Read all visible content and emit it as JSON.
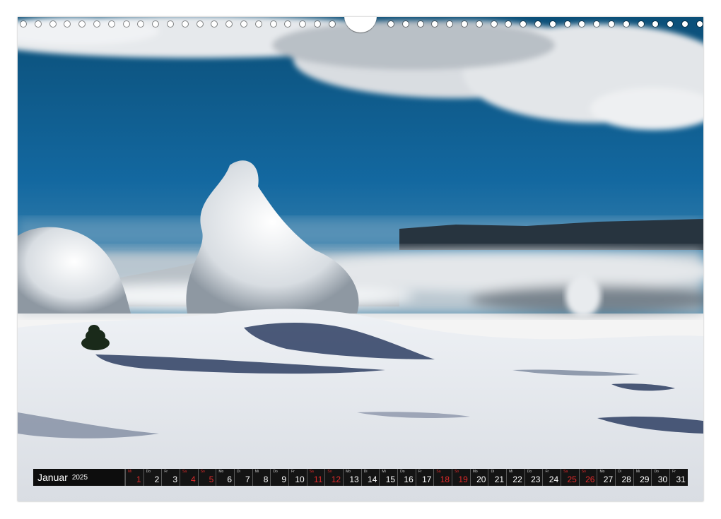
{
  "calendar": {
    "month": "Januar",
    "year": "2025",
    "days": [
      {
        "num": "1",
        "wd": "Mi",
        "weekend": true
      },
      {
        "num": "2",
        "wd": "Do",
        "weekend": false
      },
      {
        "num": "3",
        "wd": "Fr",
        "weekend": false
      },
      {
        "num": "4",
        "wd": "Sa",
        "weekend": true
      },
      {
        "num": "5",
        "wd": "So",
        "weekend": true
      },
      {
        "num": "6",
        "wd": "Mo",
        "weekend": false
      },
      {
        "num": "7",
        "wd": "Di",
        "weekend": false
      },
      {
        "num": "8",
        "wd": "Mi",
        "weekend": false
      },
      {
        "num": "9",
        "wd": "Do",
        "weekend": false
      },
      {
        "num": "10",
        "wd": "Fr",
        "weekend": false
      },
      {
        "num": "11",
        "wd": "Sa",
        "weekend": true
      },
      {
        "num": "12",
        "wd": "So",
        "weekend": true
      },
      {
        "num": "13",
        "wd": "Mo",
        "weekend": false
      },
      {
        "num": "14",
        "wd": "Di",
        "weekend": false
      },
      {
        "num": "15",
        "wd": "Mi",
        "weekend": false
      },
      {
        "num": "16",
        "wd": "Do",
        "weekend": false
      },
      {
        "num": "17",
        "wd": "Fr",
        "weekend": false
      },
      {
        "num": "18",
        "wd": "Sa",
        "weekend": true
      },
      {
        "num": "19",
        "wd": "So",
        "weekend": true
      },
      {
        "num": "20",
        "wd": "Mo",
        "weekend": false
      },
      {
        "num": "21",
        "wd": "Di",
        "weekend": false
      },
      {
        "num": "22",
        "wd": "Mi",
        "weekend": false
      },
      {
        "num": "23",
        "wd": "Do",
        "weekend": false
      },
      {
        "num": "24",
        "wd": "Fr",
        "weekend": false
      },
      {
        "num": "25",
        "wd": "Sa",
        "weekend": true
      },
      {
        "num": "26",
        "wd": "So",
        "weekend": true
      },
      {
        "num": "27",
        "wd": "Mo",
        "weekend": false
      },
      {
        "num": "28",
        "wd": "Di",
        "weekend": false
      },
      {
        "num": "29",
        "wd": "Mi",
        "weekend": false
      },
      {
        "num": "30",
        "wd": "Do",
        "weekend": false
      },
      {
        "num": "31",
        "wd": "Fr",
        "weekend": false
      }
    ]
  },
  "colors": {
    "sky": "#0f5b86",
    "weekend": "#e02a2a",
    "strip": "#141414"
  }
}
